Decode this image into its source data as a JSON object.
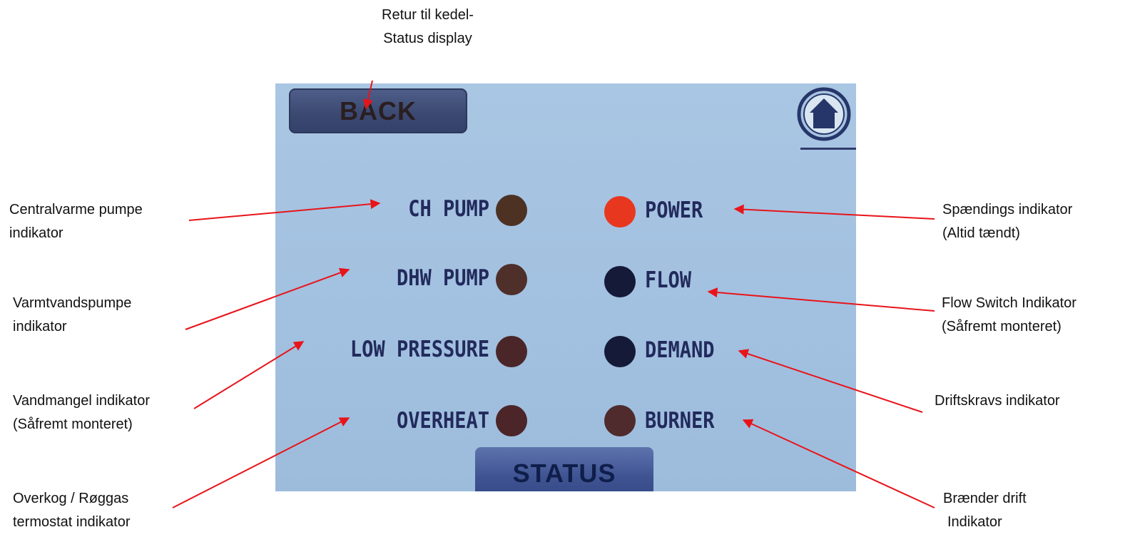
{
  "panel": {
    "back_label": "BACK",
    "status_label": "STATUS",
    "home_icon": "home-icon"
  },
  "indicators_left": [
    {
      "label": "CH PUMP",
      "color": "#4d3224"
    },
    {
      "label": "DHW PUMP",
      "color": "#4e2f2a"
    },
    {
      "label": "LOW PRESSURE",
      "color": "#4a2628"
    },
    {
      "label": "OVERHEAT",
      "color": "#4b2528"
    }
  ],
  "indicators_right": [
    {
      "label": "POWER",
      "color": "#e8371f"
    },
    {
      "label": "FLOW",
      "color": "#151a38"
    },
    {
      "label": "DEMAND",
      "color": "#151a38"
    },
    {
      "label": "BURNER",
      "color": "#4f2b2d"
    }
  ],
  "annotations": {
    "back": {
      "line1": "Retur til kedel-",
      "line2": "Status display"
    },
    "ch_pump": {
      "line1": "Centralvarme pumpe",
      "line2": "indikator"
    },
    "dhw_pump": {
      "line1": "Varmtvandspumpe",
      "line2": "indikator"
    },
    "low_pressure": {
      "line1": "Vandmangel indikator",
      "line2": "(Såfremt monteret)"
    },
    "overheat": {
      "line1": "Overkog / Røggas",
      "line2": "termostat indikator"
    },
    "power": {
      "line1": "Spændings indikator",
      "line2": "(Altid tændt)"
    },
    "flow": {
      "line1": "Flow Switch Indikator",
      "line2": "(Såfremt monteret)"
    },
    "demand": {
      "line1": "Driftskravs indikator"
    },
    "burner": {
      "line1": "Brænder drift",
      "line2": "Indikator"
    }
  },
  "colors": {
    "arrow": "#e8141a",
    "screen_bg": "#a3c1e0",
    "label_text": "#222a5c"
  }
}
